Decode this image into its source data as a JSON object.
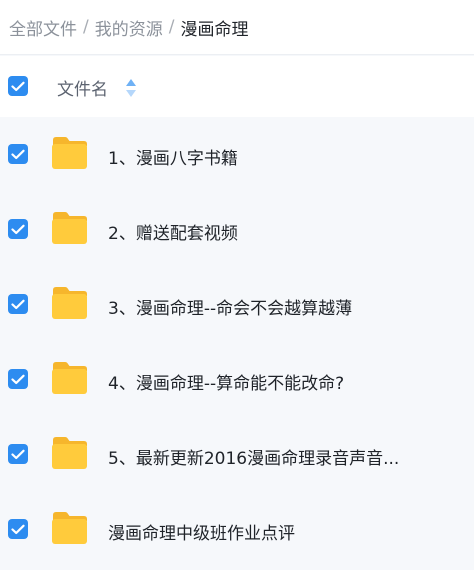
{
  "breadcrumb": {
    "items": [
      "全部文件",
      "我的资源"
    ],
    "separator": "/",
    "current": "漫画命理"
  },
  "header": {
    "column_title": "文件名"
  },
  "files": [
    {
      "name": "1、漫画八字书籍"
    },
    {
      "name": "2、赠送配套视频"
    },
    {
      "name": "3、漫画命理--命会不会越算越薄"
    },
    {
      "name": "4、漫画命理--算命能不能改命?"
    },
    {
      "name": "5、最新更新2016漫画命理录音声音..."
    },
    {
      "name": "漫画命理中级班作业点评"
    }
  ],
  "colors": {
    "accent": "#2d8cf0",
    "folder": "#ffc83d"
  }
}
